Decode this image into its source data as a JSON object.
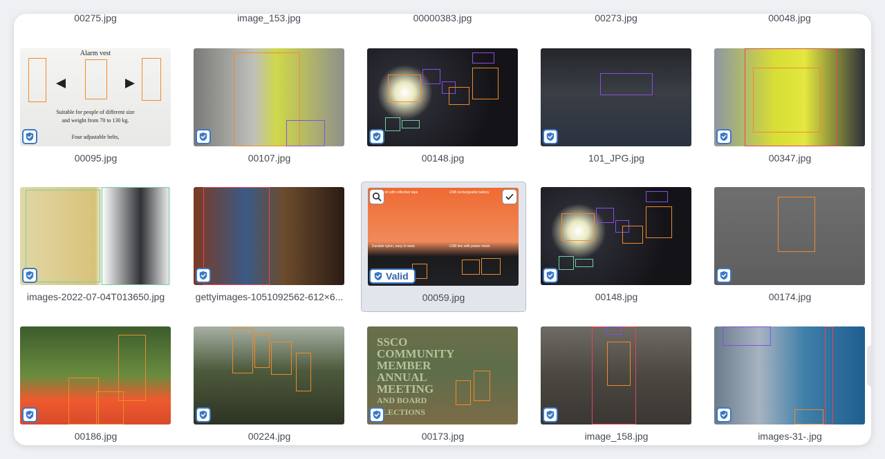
{
  "top_row": [
    "00275.jpg",
    "image_153.jpg",
    "00000383.jpg",
    "00273.jpg",
    "00048.jpg"
  ],
  "rows": [
    [
      {
        "filename": "00095.jpg",
        "scene": "vest-poster"
      },
      {
        "filename": "00107.jpg",
        "scene": "vest-man"
      },
      {
        "filename": "00148.jpg",
        "scene": "night"
      },
      {
        "filename": "101_JPG.jpg",
        "scene": "helmet"
      },
      {
        "filename": "00347.jpg",
        "scene": "yellow-vest"
      }
    ],
    [
      {
        "filename": "images-2022-07-04T013650.jpg",
        "scene": "gloves"
      },
      {
        "filename": "gettyimages-1051092562-612×6...",
        "scene": "grinder"
      },
      {
        "filename": "00059.jpg",
        "scene": "orange-product",
        "selected": true,
        "status": "Valid"
      },
      {
        "filename": "00148.jpg",
        "scene": "night"
      },
      {
        "filename": "00174.jpg",
        "scene": "vest-back"
      }
    ],
    [
      {
        "filename": "00186.jpg",
        "scene": "orange-crew"
      },
      {
        "filename": "00224.jpg",
        "scene": "group"
      },
      {
        "filename": "00173.jpg",
        "scene": "community",
        "overlay_text": [
          "SSCO",
          "COMMUNITY",
          "MEMBER",
          "ANNUAL",
          "MEETING",
          "AND BOARD",
          "ELECTIONS"
        ]
      },
      {
        "filename": "image_158.jpg",
        "scene": "street"
      },
      {
        "filename": "images-31-.jpg",
        "scene": "climber"
      }
    ]
  ],
  "poster": {
    "title": "Alarm vest",
    "line1": "Suitable for people of different size",
    "line2": "and weight from 70 to 130 kg.",
    "line3": "Four adjustable belts,"
  },
  "product": {
    "t1": "Blue mesh with reflective tape",
    "t2": "USB rechargeable battery",
    "t3": "Durable nylon, easy to wear",
    "t4": "USB line with power meter"
  },
  "icons": {
    "status": "shield-check-icon",
    "zoom": "search-icon",
    "select": "checkmark-icon"
  },
  "colors": {
    "accent": "#3a79c4",
    "box_orange": "#f08a2c",
    "box_purple": "#8a4de0",
    "box_green": "#6fd3a0",
    "box_red": "#e8445a"
  }
}
